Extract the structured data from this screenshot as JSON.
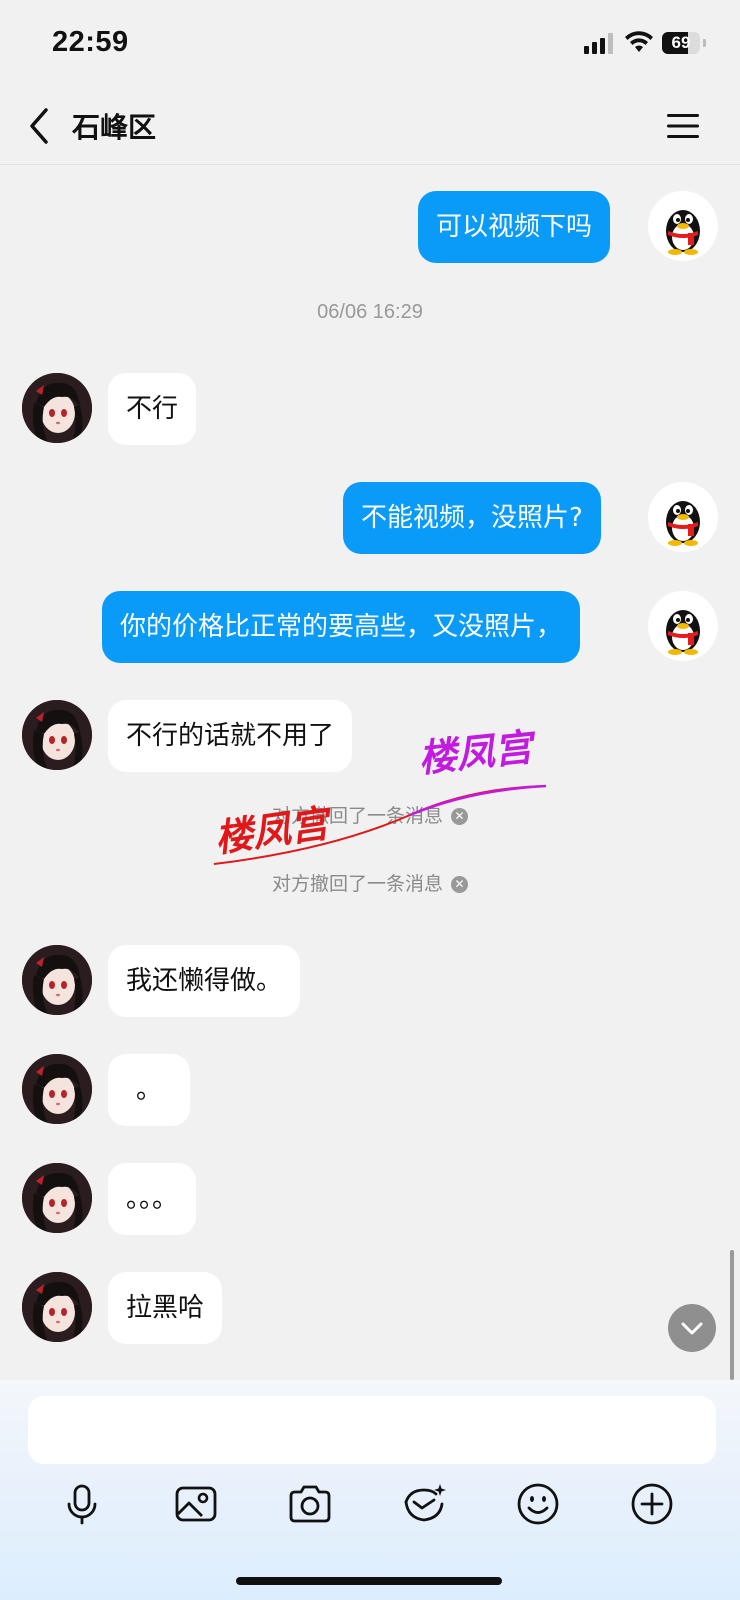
{
  "status": {
    "time": "22:59",
    "battery": "69",
    "battery_level": 0.69,
    "icons": [
      "signal-icon",
      "wifi-icon",
      "battery-icon"
    ]
  },
  "header": {
    "title": "石峰区",
    "back_icon": "chevron-left-icon",
    "menu_icon": "hamburger-menu-icon"
  },
  "messages": [
    {
      "from": "me",
      "text": "可以视频下吗"
    },
    {
      "type": "timestamp",
      "text": "06/06 16:29"
    },
    {
      "from": "her",
      "text": "不行"
    },
    {
      "from": "me",
      "text": "不能视频，没照片?"
    },
    {
      "from": "me",
      "text": "你的价格比正常的要高些，又没照片，"
    },
    {
      "from": "her",
      "text": "不行的话就不用了"
    },
    {
      "type": "system",
      "text": "对方撤回了一条消息"
    },
    {
      "type": "system",
      "text": "对方撤回了一条消息"
    },
    {
      "from": "her",
      "text": "我还懒得做。"
    },
    {
      "from": "her",
      "text": "。"
    },
    {
      "from": "her",
      "text": "。。。"
    },
    {
      "from": "her",
      "text": "拉黑哈"
    }
  ],
  "watermark": {
    "text": "楼凤宫",
    "colors": [
      "#e0181a",
      "#c21be0"
    ]
  },
  "composer": {
    "input_value": "",
    "tools": [
      "microphone-icon",
      "image-icon",
      "camera-icon",
      "red-packet-icon",
      "emoji-icon",
      "plus-icon"
    ]
  },
  "colors": {
    "my_bubble": "#0a9af8",
    "their_bubble": "#ffffff",
    "background": "#f1f1f1"
  }
}
